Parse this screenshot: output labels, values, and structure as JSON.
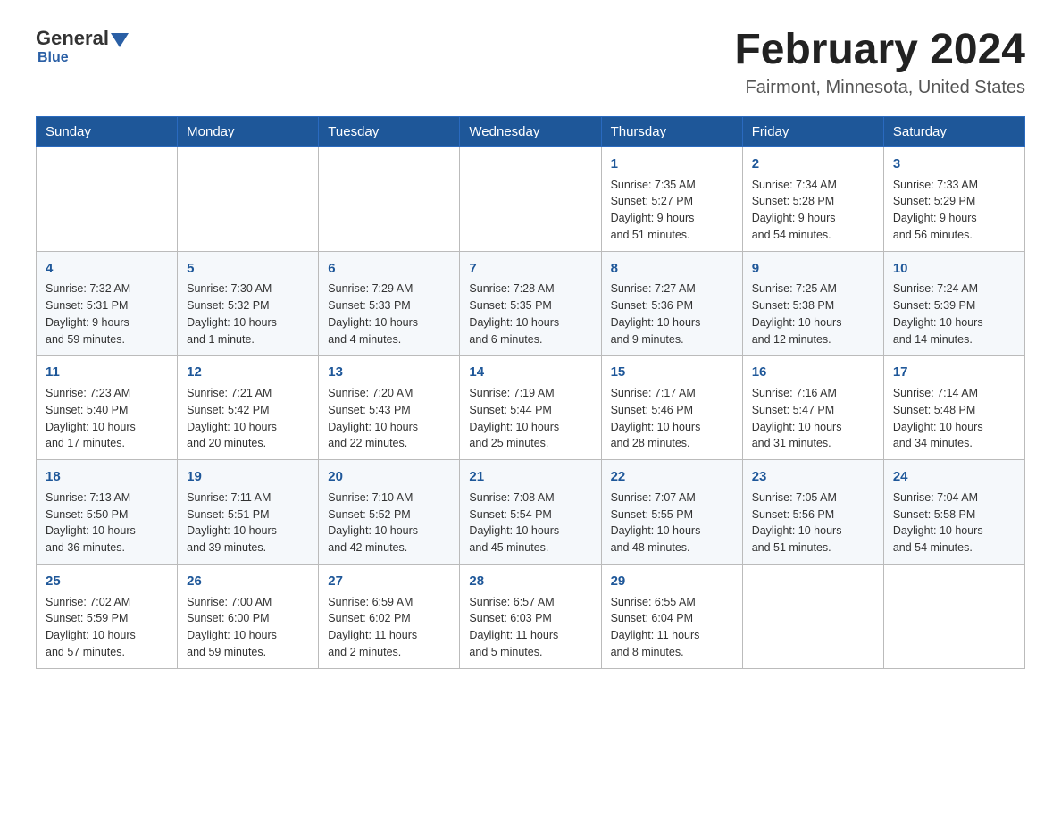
{
  "header": {
    "logo_general": "General",
    "logo_blue": "Blue",
    "month_title": "February 2024",
    "location": "Fairmont, Minnesota, United States"
  },
  "calendar": {
    "days_of_week": [
      "Sunday",
      "Monday",
      "Tuesday",
      "Wednesday",
      "Thursday",
      "Friday",
      "Saturday"
    ],
    "weeks": [
      [
        {
          "day": "",
          "info": ""
        },
        {
          "day": "",
          "info": ""
        },
        {
          "day": "",
          "info": ""
        },
        {
          "day": "",
          "info": ""
        },
        {
          "day": "1",
          "info": "Sunrise: 7:35 AM\nSunset: 5:27 PM\nDaylight: 9 hours\nand 51 minutes."
        },
        {
          "day": "2",
          "info": "Sunrise: 7:34 AM\nSunset: 5:28 PM\nDaylight: 9 hours\nand 54 minutes."
        },
        {
          "day": "3",
          "info": "Sunrise: 7:33 AM\nSunset: 5:29 PM\nDaylight: 9 hours\nand 56 minutes."
        }
      ],
      [
        {
          "day": "4",
          "info": "Sunrise: 7:32 AM\nSunset: 5:31 PM\nDaylight: 9 hours\nand 59 minutes."
        },
        {
          "day": "5",
          "info": "Sunrise: 7:30 AM\nSunset: 5:32 PM\nDaylight: 10 hours\nand 1 minute."
        },
        {
          "day": "6",
          "info": "Sunrise: 7:29 AM\nSunset: 5:33 PM\nDaylight: 10 hours\nand 4 minutes."
        },
        {
          "day": "7",
          "info": "Sunrise: 7:28 AM\nSunset: 5:35 PM\nDaylight: 10 hours\nand 6 minutes."
        },
        {
          "day": "8",
          "info": "Sunrise: 7:27 AM\nSunset: 5:36 PM\nDaylight: 10 hours\nand 9 minutes."
        },
        {
          "day": "9",
          "info": "Sunrise: 7:25 AM\nSunset: 5:38 PM\nDaylight: 10 hours\nand 12 minutes."
        },
        {
          "day": "10",
          "info": "Sunrise: 7:24 AM\nSunset: 5:39 PM\nDaylight: 10 hours\nand 14 minutes."
        }
      ],
      [
        {
          "day": "11",
          "info": "Sunrise: 7:23 AM\nSunset: 5:40 PM\nDaylight: 10 hours\nand 17 minutes."
        },
        {
          "day": "12",
          "info": "Sunrise: 7:21 AM\nSunset: 5:42 PM\nDaylight: 10 hours\nand 20 minutes."
        },
        {
          "day": "13",
          "info": "Sunrise: 7:20 AM\nSunset: 5:43 PM\nDaylight: 10 hours\nand 22 minutes."
        },
        {
          "day": "14",
          "info": "Sunrise: 7:19 AM\nSunset: 5:44 PM\nDaylight: 10 hours\nand 25 minutes."
        },
        {
          "day": "15",
          "info": "Sunrise: 7:17 AM\nSunset: 5:46 PM\nDaylight: 10 hours\nand 28 minutes."
        },
        {
          "day": "16",
          "info": "Sunrise: 7:16 AM\nSunset: 5:47 PM\nDaylight: 10 hours\nand 31 minutes."
        },
        {
          "day": "17",
          "info": "Sunrise: 7:14 AM\nSunset: 5:48 PM\nDaylight: 10 hours\nand 34 minutes."
        }
      ],
      [
        {
          "day": "18",
          "info": "Sunrise: 7:13 AM\nSunset: 5:50 PM\nDaylight: 10 hours\nand 36 minutes."
        },
        {
          "day": "19",
          "info": "Sunrise: 7:11 AM\nSunset: 5:51 PM\nDaylight: 10 hours\nand 39 minutes."
        },
        {
          "day": "20",
          "info": "Sunrise: 7:10 AM\nSunset: 5:52 PM\nDaylight: 10 hours\nand 42 minutes."
        },
        {
          "day": "21",
          "info": "Sunrise: 7:08 AM\nSunset: 5:54 PM\nDaylight: 10 hours\nand 45 minutes."
        },
        {
          "day": "22",
          "info": "Sunrise: 7:07 AM\nSunset: 5:55 PM\nDaylight: 10 hours\nand 48 minutes."
        },
        {
          "day": "23",
          "info": "Sunrise: 7:05 AM\nSunset: 5:56 PM\nDaylight: 10 hours\nand 51 minutes."
        },
        {
          "day": "24",
          "info": "Sunrise: 7:04 AM\nSunset: 5:58 PM\nDaylight: 10 hours\nand 54 minutes."
        }
      ],
      [
        {
          "day": "25",
          "info": "Sunrise: 7:02 AM\nSunset: 5:59 PM\nDaylight: 10 hours\nand 57 minutes."
        },
        {
          "day": "26",
          "info": "Sunrise: 7:00 AM\nSunset: 6:00 PM\nDaylight: 10 hours\nand 59 minutes."
        },
        {
          "day": "27",
          "info": "Sunrise: 6:59 AM\nSunset: 6:02 PM\nDaylight: 11 hours\nand 2 minutes."
        },
        {
          "day": "28",
          "info": "Sunrise: 6:57 AM\nSunset: 6:03 PM\nDaylight: 11 hours\nand 5 minutes."
        },
        {
          "day": "29",
          "info": "Sunrise: 6:55 AM\nSunset: 6:04 PM\nDaylight: 11 hours\nand 8 minutes."
        },
        {
          "day": "",
          "info": ""
        },
        {
          "day": "",
          "info": ""
        }
      ]
    ]
  },
  "colors": {
    "header_bg": "#1e5799",
    "header_text": "#ffffff",
    "day_number": "#1e5799",
    "border": "#bbbbbb",
    "row_odd": "#ffffff",
    "row_even": "#f5f8fb"
  }
}
